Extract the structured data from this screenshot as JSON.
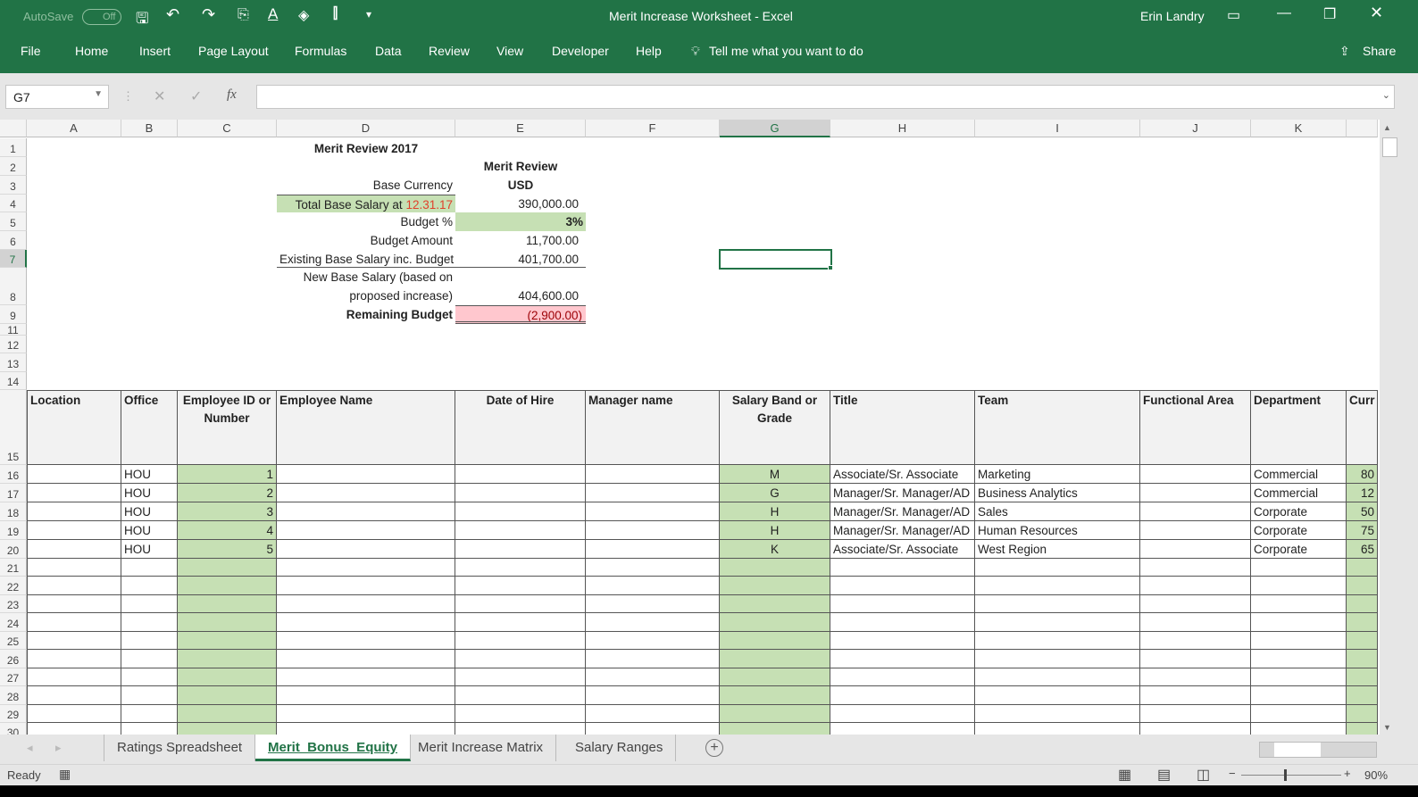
{
  "titlebar": {
    "autosave": "AutoSave",
    "autosave_state": "Off",
    "title": "Merit Increase Worksheet  -  Excel",
    "user": "Erin Landry"
  },
  "ribbon": {
    "tabs": [
      "File",
      "Home",
      "Insert",
      "Page Layout",
      "Formulas",
      "Data",
      "Review",
      "View",
      "Developer",
      "Help"
    ],
    "tell_me": "Tell me what you want to do",
    "share": "Share"
  },
  "formula_bar": {
    "name_box": "G7",
    "fx": "fx",
    "value": ""
  },
  "columns": [
    "A",
    "B",
    "C",
    "D",
    "E",
    "F",
    "G",
    "H",
    "I",
    "J",
    "K"
  ],
  "selected_cell": "G7",
  "summary": {
    "title": "Merit Review 2017",
    "col_header": "Merit Review",
    "base_currency_label": "Base Currency",
    "base_currency": "USD",
    "total_base_label": "Total Base Salary at ",
    "total_base_date": "12.31.17",
    "total_base": "390,000.00",
    "budget_pct_label": "Budget %",
    "budget_pct": "3%",
    "budget_amount_label": "Budget Amount",
    "budget_amount": "11,700.00",
    "existing_label": "Existing Base Salary inc. Budget",
    "existing": "401,700.00",
    "new_label_1": "New Base Salary (based on",
    "new_label_2": "proposed increase)",
    "new_value": "404,600.00",
    "remaining_label": "Remaining Budget",
    "remaining": "(2,900.00)"
  },
  "table": {
    "headers": [
      "Location",
      "Office",
      "Employee ID or Number",
      "Employee Name",
      "Date of Hire",
      "Manager name",
      "Salary Band or Grade",
      "Title",
      "Team",
      "Functional Area",
      "Department",
      "Curr"
    ],
    "rows": [
      [
        "",
        "HOU",
        "1",
        "",
        "",
        "",
        "M",
        "Associate/Sr. Associate",
        "Marketing",
        "",
        "Commercial",
        "80"
      ],
      [
        "",
        "HOU",
        "2",
        "",
        "",
        "",
        "G",
        "Manager/Sr. Manager/AD",
        "Business Analytics",
        "",
        "Commercial",
        "12"
      ],
      [
        "",
        "HOU",
        "3",
        "",
        "",
        "",
        "H",
        "Manager/Sr. Manager/AD",
        "Sales",
        "",
        "Corporate",
        "50"
      ],
      [
        "",
        "HOU",
        "4",
        "",
        "",
        "",
        "H",
        "Manager/Sr. Manager/AD",
        "Human Resources",
        "",
        "Corporate",
        "75"
      ],
      [
        "",
        "HOU",
        "5",
        "",
        "",
        "",
        "K",
        "Associate/Sr. Associate",
        "West Region",
        "",
        "Corporate",
        "65"
      ]
    ]
  },
  "row_numbers": [
    "1",
    "2",
    "3",
    "4",
    "5",
    "6",
    "7",
    "8",
    "9",
    "11",
    "12",
    "13",
    "14",
    "15",
    "16",
    "17",
    "18",
    "19",
    "20",
    "21",
    "22",
    "23",
    "24",
    "25",
    "26",
    "27",
    "28",
    "29",
    "30"
  ],
  "sheet_tabs": [
    "Ratings Spreadsheet",
    "Merit_Bonus_Equity",
    "Merit Increase Matrix",
    "Salary Ranges"
  ],
  "active_tab": "Merit_Bonus_Equity",
  "status": {
    "ready": "Ready",
    "zoom": "90%"
  },
  "colors": {
    "excel_green": "#217346",
    "input_green": "#c6e0b4",
    "negative_red": "#ffc7ce",
    "date_red": "#e0412b"
  }
}
